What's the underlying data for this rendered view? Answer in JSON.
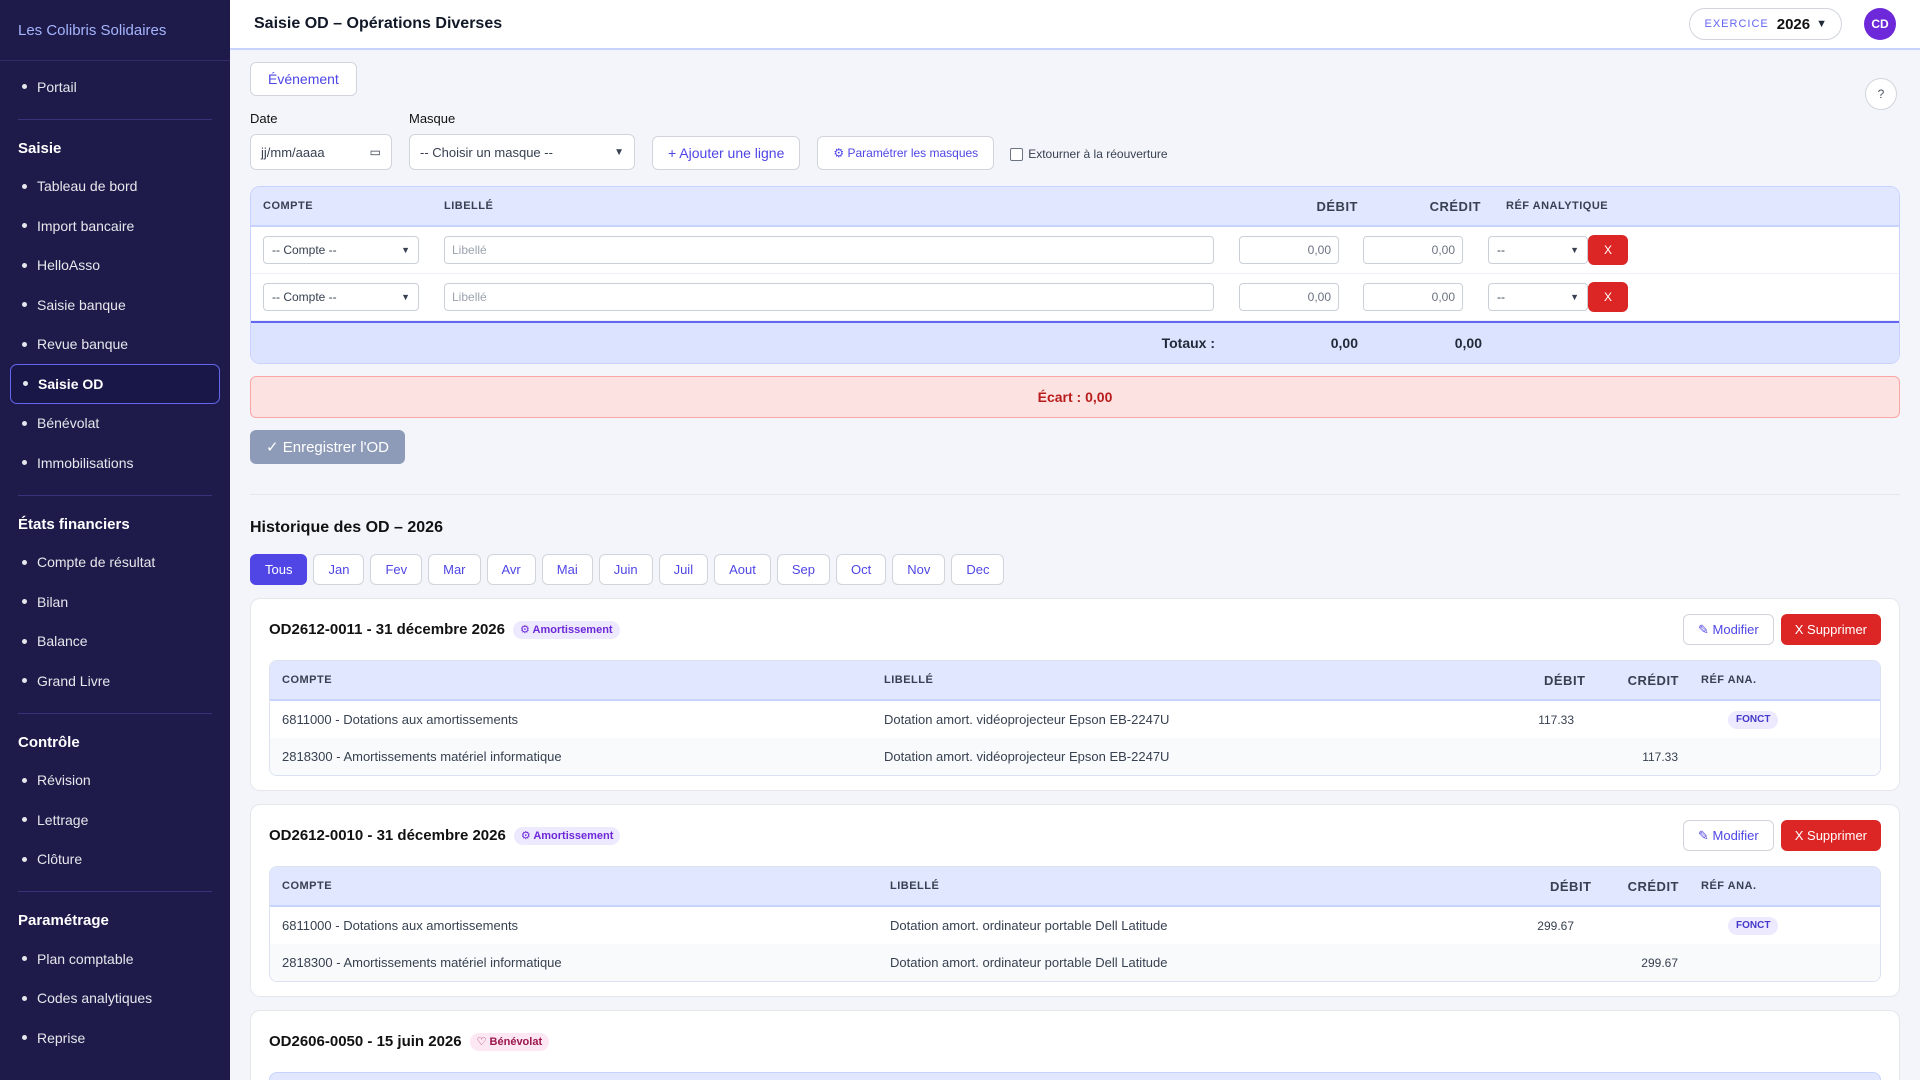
{
  "sidebar": {
    "brand": "Les Colibris Solidaires",
    "portal": "Portail",
    "sections": [
      {
        "title": "Saisie",
        "items": [
          "Tableau de bord",
          "Import bancaire",
          "HelloAsso",
          "Saisie banque",
          "Revue banque",
          "Saisie OD",
          "Bénévolat",
          "Immobilisations"
        ]
      },
      {
        "title": "États financiers",
        "items": [
          "Compte de résultat",
          "Bilan",
          "Balance",
          "Grand Livre"
        ]
      },
      {
        "title": "Contrôle",
        "items": [
          "Révision",
          "Lettrage",
          "Clôture"
        ]
      },
      {
        "title": "Paramétrage",
        "items": [
          "Plan comptable",
          "Codes analytiques",
          "Reprise"
        ]
      }
    ],
    "active_item": "Saisie OD"
  },
  "header": {
    "title": "Saisie OD – Opérations Diverses",
    "exercice_label": "EXERCICE",
    "exercice_value": "2026",
    "avatar": "CD"
  },
  "form": {
    "event_button": "Événement",
    "help": "?",
    "date_label": "Date",
    "date_placeholder": "jj/mm/aaaa",
    "mask_label": "Masque",
    "mask_value": "-- Choisir un masque --",
    "add_line": "+ Ajouter une ligne",
    "config_masks": "⚙ Paramétrer les masques",
    "extourner": "Extourner à la réouverture"
  },
  "entry": {
    "headers": {
      "compte": "COMPTE",
      "libelle": "LIBELLÉ",
      "debit": "DÉBIT",
      "credit": "CRÉDIT",
      "ref": "RÉF ANALYTIQUE"
    },
    "rows": [
      {
        "compte": "-- Compte --",
        "libelle": "Libellé",
        "debit": "0,00",
        "credit": "0,00",
        "ref": "--",
        "delete": "X"
      },
      {
        "compte": "-- Compte --",
        "libelle": "Libellé",
        "debit": "0,00",
        "credit": "0,00",
        "ref": "--",
        "delete": "X"
      }
    ],
    "totals_label": "Totaux :",
    "total_debit": "0,00",
    "total_credit": "0,00",
    "ecart": "Écart : 0,00",
    "save": "✓ Enregistrer l'OD"
  },
  "history": {
    "title": "Historique des OD – 2026",
    "months": [
      "Tous",
      "Jan",
      "Fev",
      "Mar",
      "Avr",
      "Mai",
      "Juin",
      "Juil",
      "Aout",
      "Sep",
      "Oct",
      "Nov",
      "Dec"
    ],
    "active_month": "Tous",
    "modify": "✎ Modifier",
    "delete": "X Supprimer",
    "cards": [
      {
        "title": "OD2612-0011 - 31 décembre 2026",
        "tag": "⚙ Amortissement",
        "headers": {
          "compte": "COMPTE",
          "libelle": "LIBELLÉ",
          "debit": "DÉBIT",
          "credit": "CRÉDIT",
          "ref": "RÉF ANA."
        },
        "rows": [
          {
            "compte": "6811000 - Dotations aux amortissements",
            "libelle": "Dotation amort. vidéoprojecteur Epson EB-2247U",
            "debit": "117.33",
            "credit": "",
            "ref": "FONCT"
          },
          {
            "compte": "2818300 - Amortissements matériel informatique",
            "libelle": "Dotation amort. vidéoprojecteur Epson EB-2247U",
            "debit": "",
            "credit": "117.33",
            "ref": ""
          }
        ]
      },
      {
        "title": "OD2612-0010 - 31 décembre 2026",
        "tag": "⚙ Amortissement",
        "headers": {
          "compte": "COMPTE",
          "libelle": "LIBELLÉ",
          "debit": "DÉBIT",
          "credit": "CRÉDIT",
          "ref": "RÉF ANA."
        },
        "rows": [
          {
            "compte": "6811000 - Dotations aux amortissements",
            "libelle": "Dotation amort. ordinateur portable Dell Latitude",
            "debit": "299.67",
            "credit": "",
            "ref": "FONCT"
          },
          {
            "compte": "2818300 - Amortissements matériel informatique",
            "libelle": "Dotation amort. ordinateur portable Dell Latitude",
            "debit": "",
            "credit": "299.67",
            "ref": ""
          }
        ]
      },
      {
        "title": "OD2606-0050 - 15 juin 2026",
        "tag": "♡ Bénévolat"
      }
    ]
  }
}
